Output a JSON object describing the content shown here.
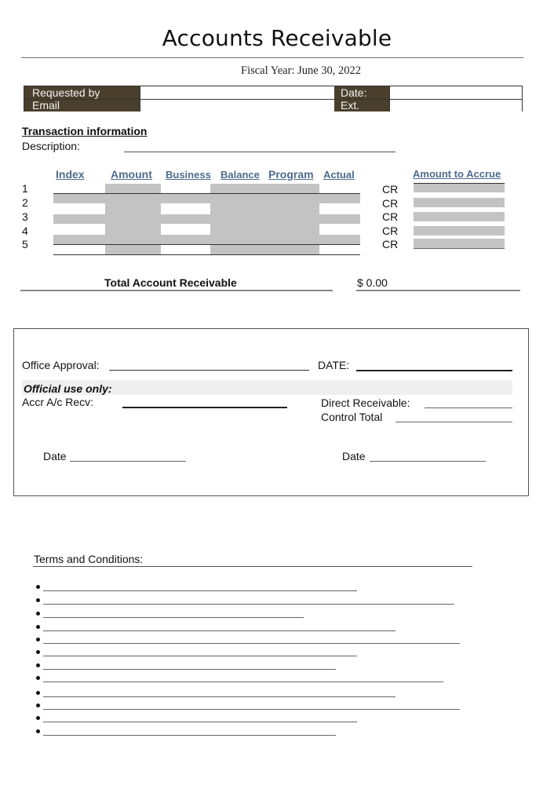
{
  "document": {
    "title": "Accounts Receivable",
    "fiscal_year": "Fiscal Year: June 30, 2022"
  },
  "header_table": {
    "requested_by_label": "Requested by",
    "requested_by_value": "",
    "email_label": "Email",
    "email_value": "",
    "date_label": "Date:",
    "date_value": "",
    "ext_label": "Ext.",
    "ext_value": ""
  },
  "transaction": {
    "section_title": "Transaction information",
    "description_label": "Description:",
    "description_value": "",
    "columns": [
      "Index",
      "Amount",
      "Business",
      "Balance",
      "Program",
      "Actual"
    ],
    "accrue_column": "Amount to Accrue",
    "rows": [
      {
        "num": "1",
        "cr": "CR",
        "amount_to_accrue": ""
      },
      {
        "num": "2",
        "cr": "CR",
        "amount_to_accrue": ""
      },
      {
        "num": "3",
        "cr": "CR",
        "amount_to_accrue": ""
      },
      {
        "num": "4",
        "cr": "CR",
        "amount_to_accrue": ""
      },
      {
        "num": "5",
        "cr": "CR",
        "amount_to_accrue": ""
      }
    ]
  },
  "total": {
    "label": "Total Account Receivable",
    "value": "$ 0.00"
  },
  "approval": {
    "office_approval_label": "Office Approval:",
    "date_label": "DATE:",
    "official_use_label": "Official use only:",
    "accr_label": "Accr A/c Recv:",
    "direct_receivable_label": "Direct Receivable:",
    "control_total_label": "Control Total",
    "date_left_label": "Date",
    "date_right_label": "Date"
  },
  "terms": {
    "label": "Terms and Conditions:",
    "items": [
      "",
      "",
      "",
      "",
      "",
      "",
      "",
      "",
      "",
      "",
      "",
      ""
    ]
  }
}
